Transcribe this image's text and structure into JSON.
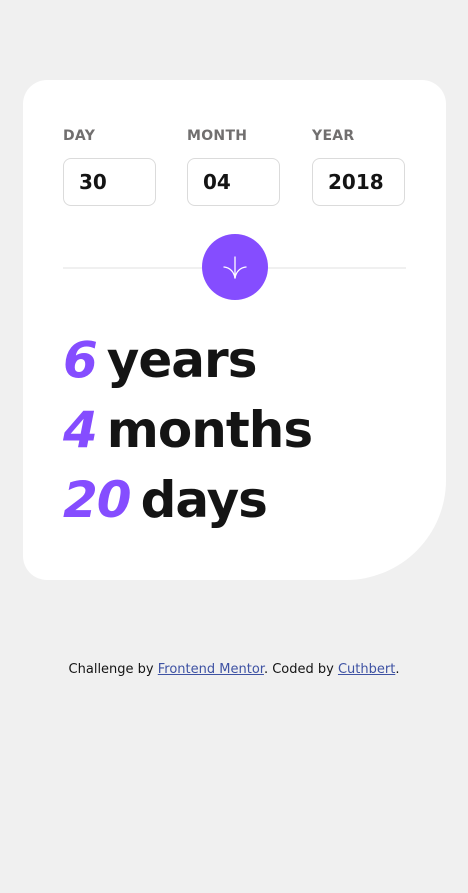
{
  "form": {
    "day_label": "DAY",
    "day_value": "30",
    "month_label": "MONTH",
    "month_value": "04",
    "year_label": "YEAR",
    "year_value": "2018"
  },
  "submit": {
    "icon": "arrow-down-icon",
    "color": "#854dff"
  },
  "results": {
    "years_value": "6",
    "years_unit": "years",
    "months_value": "4",
    "months_unit": "months",
    "days_value": "20",
    "days_unit": "days"
  },
  "attribution": {
    "prefix": "Challenge by ",
    "link1": "Frontend Mentor",
    "middle": ". Coded by ",
    "link2": "Cuthbert",
    "suffix": "."
  },
  "colors": {
    "accent": "#854dff",
    "text_dark": "#141414",
    "label_grey": "#716f6f",
    "background": "#f0f0f0",
    "link": "#3e52a3"
  }
}
